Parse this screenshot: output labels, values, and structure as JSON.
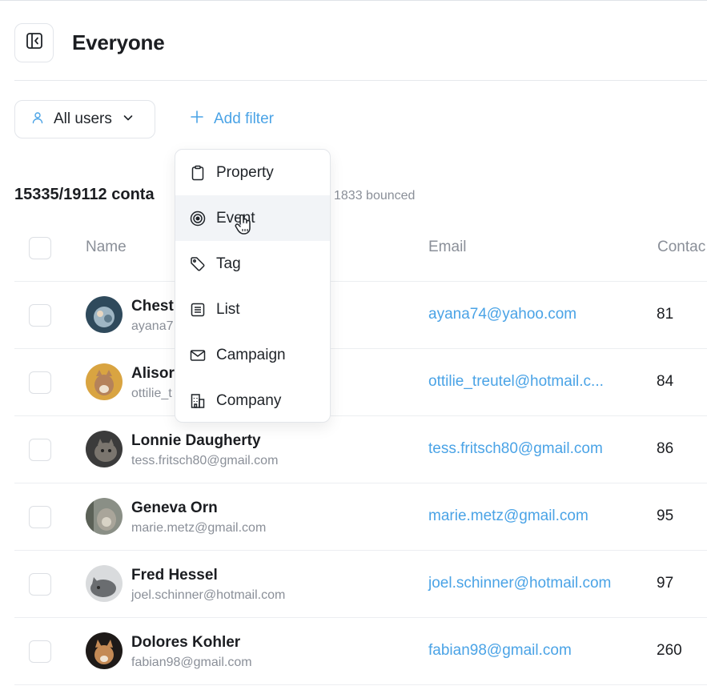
{
  "header": {
    "title": "Everyone"
  },
  "segment": {
    "label": "All users"
  },
  "add_filter": {
    "label": "Add filter"
  },
  "summary": {
    "text": "15335/19112 conta",
    "bounced": "1833 bounced"
  },
  "table": {
    "columns": [
      "Name",
      "Email",
      "Contac"
    ],
    "rows": [
      {
        "name": "Chest",
        "sub": "ayana7",
        "email": "ayana74@yahoo.com",
        "count": "81",
        "avatar_color": "#2f4a5c"
      },
      {
        "name": "Alisor",
        "sub": "ottilie_t",
        "email": "ottilie_treutel@hotmail.c...",
        "count": "84",
        "avatar_color": "#d9a441"
      },
      {
        "name": "Lonnie Daugherty",
        "sub": "tess.fritsch80@gmail.com",
        "email": "tess.fritsch80@gmail.com",
        "count": "86",
        "avatar_color": "#3b3b3b"
      },
      {
        "name": "Geneva Orn",
        "sub": "marie.metz@gmail.com",
        "email": "marie.metz@gmail.com",
        "count": "95",
        "avatar_color": "#8a8f86"
      },
      {
        "name": "Fred Hessel",
        "sub": "joel.schinner@hotmail.com",
        "email": "joel.schinner@hotmail.com",
        "count": "97",
        "avatar_color": "#c9cbcd"
      },
      {
        "name": "Dolores Kohler",
        "sub": "fabian98@gmail.com",
        "email": "fabian98@gmail.com",
        "count": "260",
        "avatar_color": "#2a2320"
      }
    ]
  },
  "filter_menu": {
    "items": [
      {
        "label": "Property",
        "icon": "clipboard-icon"
      },
      {
        "label": "Event",
        "icon": "target-icon"
      },
      {
        "label": "Tag",
        "icon": "tag-icon"
      },
      {
        "label": "List",
        "icon": "list-icon"
      },
      {
        "label": "Campaign",
        "icon": "mail-icon"
      },
      {
        "label": "Company",
        "icon": "building-icon"
      }
    ],
    "active_index": 1
  },
  "colors": {
    "accent": "#4aa3e6",
    "muted": "#8a8f98",
    "border": "#e2e5ea"
  }
}
